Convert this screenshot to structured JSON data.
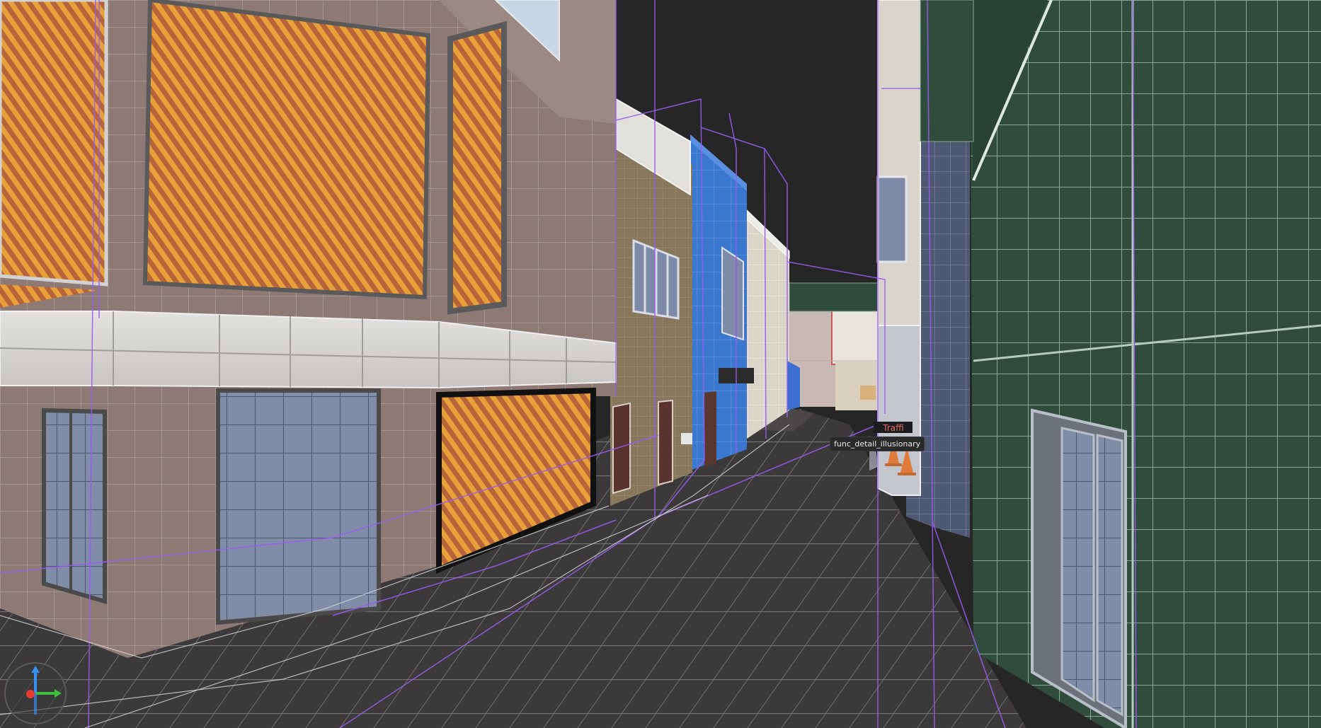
{
  "viewport": {
    "background_color": "#262626",
    "wireframe_color": "#e8e8e8",
    "trigger_outline_color": "#9a5cf0"
  },
  "tooltip": {
    "text": "func_detail_illusionary"
  },
  "sign": {
    "text": "Traffi"
  },
  "gizmo": {
    "name": "axis-gizmo",
    "axis_colors": {
      "x": "#3fbf3f",
      "y": "#e63b2e",
      "z": "#3a8ff0"
    }
  },
  "textures": {
    "brick_pink": "#8f7b76",
    "brick_tan": "#8a7d63",
    "billboard_orange": "#e39d35",
    "billboard_red": "#b06a3a",
    "glass_blue": "#7f8ba6",
    "trim_white": "#d7d7d4",
    "building_blue": "#3c7ad0",
    "building_green": "#2c4a3a",
    "street_dark": "#3a3838",
    "cone_orange": "#e07a3a"
  }
}
